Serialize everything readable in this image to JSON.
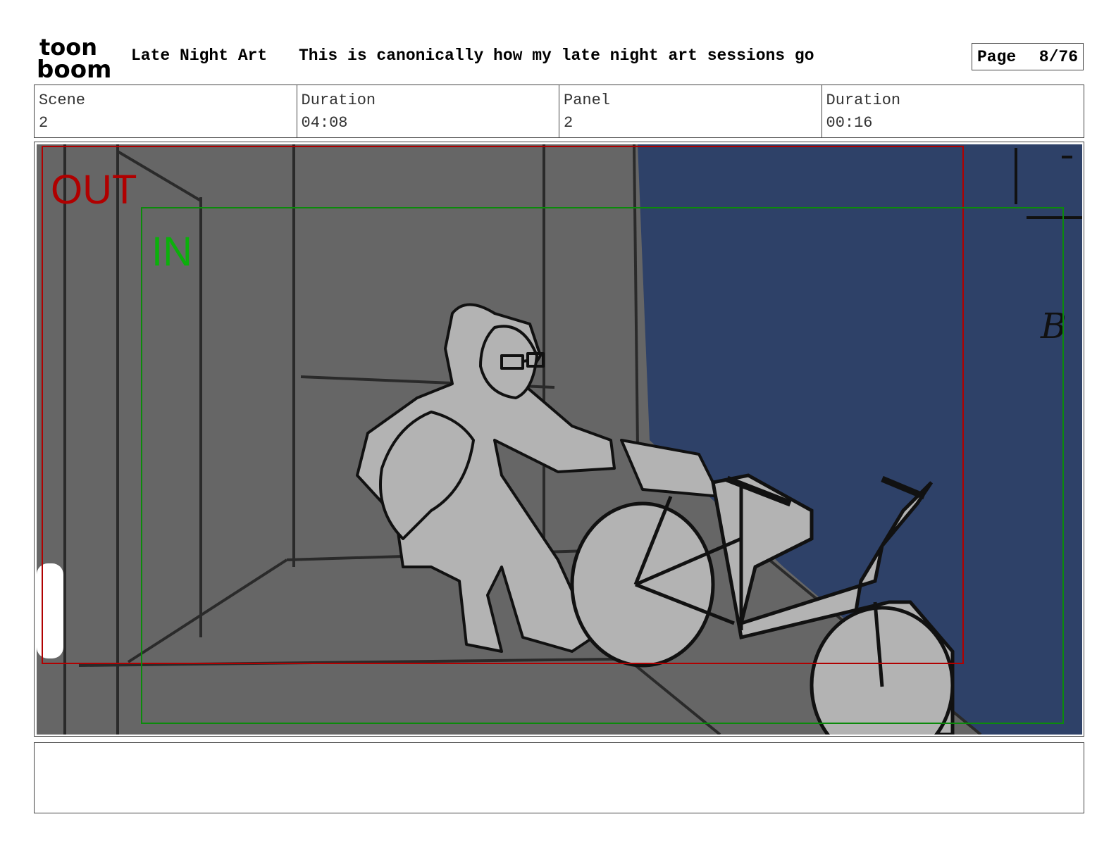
{
  "logo": {
    "line1": "toon",
    "line2": "boom",
    "name": "toon-boom-logo"
  },
  "header": {
    "project_title": "Late Night Art",
    "project_description": "This is canonically how my late night art sessions go",
    "page_label": "Page",
    "page_value": "8/76"
  },
  "info": {
    "scene_label": "Scene",
    "scene_value": "2",
    "scene_duration_label": "Duration",
    "scene_duration_value": "04:08",
    "panel_label": "Panel",
    "panel_value": "2",
    "panel_duration_label": "Duration",
    "panel_duration_value": "00:16"
  },
  "panel": {
    "out_label": "OUT",
    "in_label": "IN",
    "wall_text": "B",
    "colors": {
      "wall_gray": "#666666",
      "wall_blue": "#2e4168",
      "figure_gray": "#b3b3b3",
      "out_frame": "#b00000",
      "in_frame": "#0b8a0b"
    }
  },
  "notes": {
    "text": ""
  }
}
